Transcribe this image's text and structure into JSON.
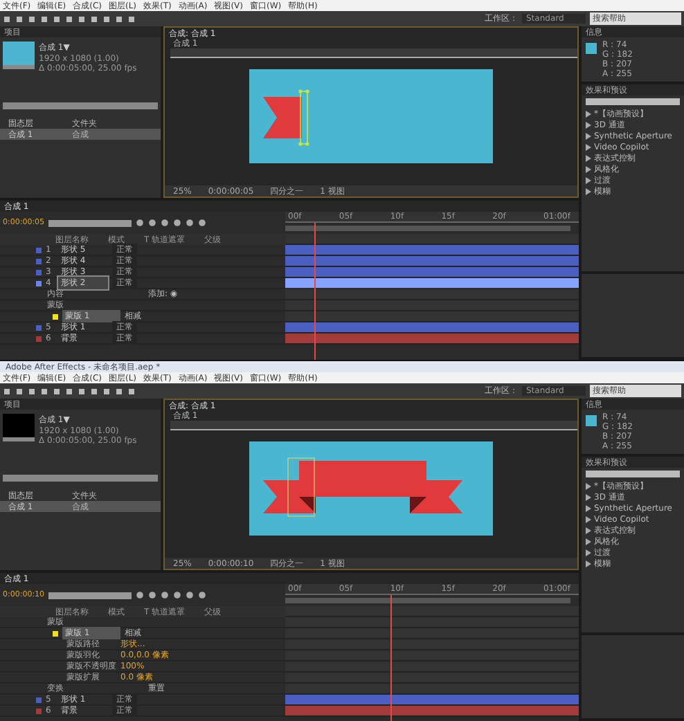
{
  "screens": [
    {
      "menu": [
        "文件(F)",
        "编辑(E)",
        "合成(C)",
        "图层(L)",
        "效果(T)",
        "动画(A)",
        "视图(V)",
        "窗口(W)",
        "帮助(H)"
      ],
      "workspace_label": "工作区：",
      "workspace": "Standard",
      "help_search": "搜索帮助",
      "project": {
        "tab": "项目",
        "comp_name": "合成 1▼",
        "comp_info": [
          "1920 x 1080 (1.00)",
          "Δ 0:00:05:00, 25.00 fps"
        ],
        "thumbnail": {
          "kind": "preview"
        },
        "items": [
          {
            "name": "固态层",
            "type": "文件夹",
            "selected": false
          },
          {
            "name": "合成 1",
            "type": "合成",
            "selected": true
          }
        ]
      },
      "viewer": {
        "tab": "合成: 合成 1",
        "crumb": "合成 1",
        "canvas": {
          "kind": "flag"
        },
        "zoom": "25%",
        "time": "0:00:00:05",
        "quality": "四分之一",
        "view": "1 视图"
      },
      "info": {
        "tab": "信息",
        "values": [
          "R : 74",
          "G : 182",
          "B : 207",
          "A : 255"
        ]
      },
      "effects": {
        "tab": "效果和预设",
        "items": [
          "*【动画预设】",
          "3D 通道",
          "Synthetic Aperture",
          "Video Copilot",
          "表达式控制",
          "风格化",
          "过渡",
          "模糊"
        ]
      },
      "timeline": {
        "tab": "合成 1",
        "time": "0:00:00:05",
        "ruler": [
          "00f",
          "05f",
          "10f",
          "15f",
          "20f",
          "01:00f"
        ],
        "playhead": {
          "level": 0.1
        },
        "columns": [
          "图层名称",
          "模式",
          "T  轨道遮罩",
          "父级"
        ],
        "rows": [
          {
            "kind": "layer",
            "num": "1",
            "name": "形状 5",
            "mode": "正常",
            "color": "#4a5fc1",
            "selected": false
          },
          {
            "kind": "layer",
            "num": "2",
            "name": "形状 4",
            "mode": "正常",
            "color": "#4a5fc1",
            "selected": false
          },
          {
            "kind": "layer",
            "num": "3",
            "name": "形状 3",
            "mode": "正常",
            "color": "#4a5fc1",
            "selected": false
          },
          {
            "kind": "layer",
            "num": "4",
            "name": "形状 2",
            "mode": "正常",
            "color": "#6d82e6",
            "selected": true
          },
          {
            "kind": "group",
            "name": "内容",
            "value": "添加: ◉"
          },
          {
            "kind": "group",
            "name": "蒙版"
          },
          {
            "kind": "mask",
            "name": "蒙版 1",
            "value": "相减",
            "selected": true
          },
          {
            "kind": "layer",
            "num": "5",
            "name": "形状 1",
            "mode": "正常",
            "color": "#4a5fc1",
            "selected": false
          },
          {
            "kind": "layer",
            "num": "6",
            "name": "背景",
            "mode": "正常",
            "color": "#a33b3b",
            "selected": false
          }
        ]
      }
    },
    {
      "title": "Adobe After Effects - 未命名项目.aep *",
      "menu": [
        "文件(F)",
        "编辑(E)",
        "合成(C)",
        "图层(L)",
        "效果(T)",
        "动画(A)",
        "视图(V)",
        "窗口(W)",
        "帮助(H)"
      ],
      "workspace_label": "工作区：",
      "workspace": "Standard",
      "help_search": "搜索帮助",
      "project": {
        "tab": "项目",
        "comp_name": "合成 1▼",
        "comp_info": [
          "1920 x 1080 (1.00)",
          "Δ 0:00:05:00, 25.00 fps"
        ],
        "thumbnail": {
          "kind": "empty"
        },
        "items": [
          {
            "name": "固态层",
            "type": "文件夹",
            "selected": false
          },
          {
            "name": "合成 1",
            "type": "合成",
            "selected": true
          }
        ]
      },
      "viewer": {
        "tab": "合成: 合成 1",
        "crumb": "合成 1",
        "canvas": {
          "kind": "banner"
        },
        "zoom": "25%",
        "time": "0:00:00:10",
        "quality": "四分之一",
        "view": "1 视图"
      },
      "info": {
        "tab": "信息",
        "values": [
          "R : 74",
          "G : 182",
          "B : 207",
          "A : 255"
        ]
      },
      "effects": {
        "tab": "效果和预设",
        "items": [
          "*【动画预设】",
          "3D 通道",
          "Synthetic Aperture",
          "Video Copilot",
          "表达式控制",
          "风格化",
          "过渡",
          "模糊"
        ]
      },
      "timeline": {
        "tab": "合成 1",
        "time": "0:00:00:10",
        "ruler": [
          "00f",
          "05f",
          "10f",
          "15f",
          "20f",
          "01:00f"
        ],
        "playhead": {
          "level": 0.37
        },
        "columns": [
          "图层名称",
          "模式",
          "T  轨道遮罩",
          "父级"
        ],
        "rows": [
          {
            "kind": "group",
            "name": "蒙版"
          },
          {
            "kind": "mask",
            "name": "蒙版 1",
            "value": "相减",
            "selected": true
          },
          {
            "kind": "property",
            "name": "蒙版路径",
            "value": "形状..."
          },
          {
            "kind": "property",
            "name": "蒙版羽化",
            "value": "0.0,0.0 像素"
          },
          {
            "kind": "property",
            "name": "蒙版不透明度",
            "value": "100%"
          },
          {
            "kind": "property",
            "name": "蒙版扩展",
            "value": "0.0 像素"
          },
          {
            "kind": "group",
            "name": "变换",
            "value": "重置"
          },
          {
            "kind": "layer",
            "num": "5",
            "name": "形状 1",
            "mode": "正常",
            "color": "#4a5fc1",
            "selected": false
          },
          {
            "kind": "layer",
            "num": "6",
            "name": "背景",
            "mode": "正常",
            "color": "#a33b3b",
            "selected": false
          }
        ]
      }
    }
  ]
}
